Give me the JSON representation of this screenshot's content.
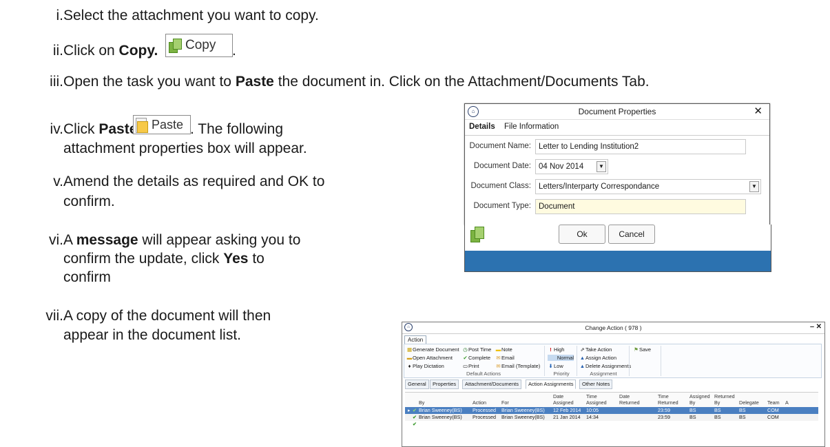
{
  "steps": [
    {
      "num": "i.",
      "parts": [
        "Select the attachment you want to copy."
      ]
    },
    {
      "num": "ii.",
      "pre": "Click on ",
      "bold": "Copy.",
      "post": "."
    },
    {
      "num": "iii.",
      "pre": "Open the task you want to ",
      "bold": "Paste",
      "post": " the document in. Click on the Attachment/Documents Tab."
    },
    {
      "num": "iv.",
      "pre": "Click ",
      "bold": "Paste",
      "post": ". The following",
      "line2": "attachment properties box will appear."
    },
    {
      "num": "v.",
      "line1": "Amend the details as required and OK to",
      "line2": "confirm."
    },
    {
      "num": "vi.",
      "pre": "A ",
      "bold": "message",
      "post": " will appear asking you to",
      "line2": "confirm the update, click ",
      "line2bold": "Yes",
      "line2post": " to",
      "line3": "confirm"
    },
    {
      "num": "vii.",
      "line1": "A copy of the document will then",
      "line2": "appear in the document list."
    }
  ],
  "copy_button": {
    "label": "Copy"
  },
  "paste_button": {
    "label": "Paste"
  },
  "doc_properties": {
    "title": "Document Properties",
    "tabs": [
      "Details",
      "File Information"
    ],
    "fields": [
      {
        "label": "Document Name:",
        "value": "Letter to Lending Institution2"
      },
      {
        "label": "Document Date:",
        "value": "04 Nov 2014"
      },
      {
        "label": "Document Class:",
        "value": "Letters/Interparty Correspondance"
      },
      {
        "label": "Document Type:",
        "value": "Document"
      }
    ],
    "ok": "Ok",
    "cancel": "Cancel"
  },
  "change_action": {
    "title": "Change Action ( 978 )",
    "ribbon_tab": "Action",
    "col1": [
      "Generate Document",
      "Open Attachment",
      "Play Dictation"
    ],
    "col2": [
      "Post Time",
      "Complete",
      "Print"
    ],
    "col3": [
      "Note",
      "Email",
      "Email (Template)"
    ],
    "group1": "Default Actions",
    "priority": [
      "High",
      "Normal",
      "Low"
    ],
    "group2": "Priority",
    "assign": [
      "Take Action",
      "Assign Action",
      "Delete Assignments"
    ],
    "group3": "Assignment",
    "save": "Save",
    "tabs": [
      "General",
      "Properties",
      "Attachment/Documents",
      "Action Assignments",
      "Other Notes"
    ],
    "headers": [
      "By",
      "Action",
      "For",
      "Date Assigned",
      "Time Assigned",
      "Date Returned",
      "Time Returned",
      "Assigned By",
      "Returned By",
      "Delegate",
      "Team",
      "A"
    ],
    "rows": [
      [
        "Brian Sweeney(BS)",
        "Processed",
        "Brian Sweeney(BS)",
        "12 Feb 2014",
        "10:05",
        "",
        "23:59",
        "BS",
        "BS",
        "BS",
        "COM"
      ],
      [
        "Brian Sweeney(BS)",
        "Processed",
        "Brian Sweeney(BS)",
        "21 Jan 2014",
        "14:34",
        "",
        "23:59",
        "BS",
        "BS",
        "BS",
        "COM"
      ]
    ]
  }
}
